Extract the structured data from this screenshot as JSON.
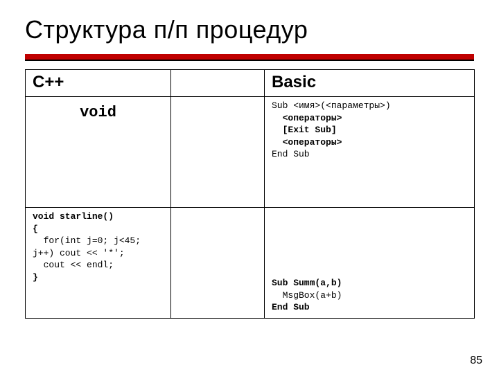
{
  "title": "Структура п/п процедур",
  "page_number": "85",
  "table": {
    "head": {
      "cpp": "С++",
      "mid": "",
      "basic": "Basic"
    },
    "body": {
      "cpp_keyword": "void",
      "mid": "",
      "basic_template_lines": [
        "Sub <имя>(<параметры>)",
        "  <операторы>",
        "  [Exit Sub]",
        "  <операторы>",
        "End Sub"
      ]
    },
    "example": {
      "cpp_lines": [
        "void starline()",
        "{",
        "  for(int j=0; j<45;",
        "j++) cout << '*';",
        "  cout << endl;",
        "}"
      ],
      "mid": "",
      "basic_lines": [
        "Sub Summ(a,b)",
        "  MsgBox(a+b)",
        "End Sub"
      ]
    }
  }
}
